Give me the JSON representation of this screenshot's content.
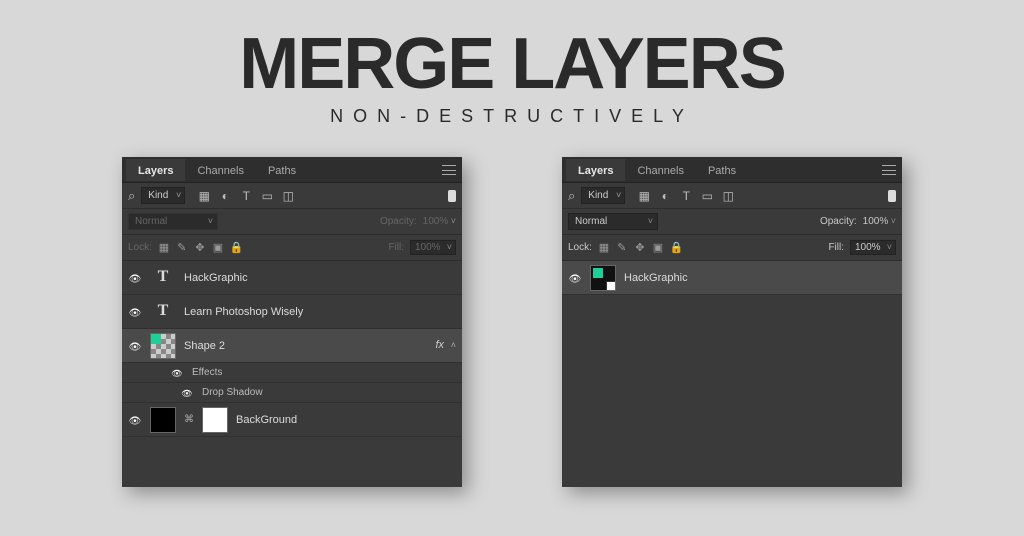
{
  "hero": {
    "title": "MERGE LAYERS",
    "subtitle": "NON-DESTRUCTIVELY"
  },
  "tabs": {
    "layers": "Layers",
    "channels": "Channels",
    "paths": "Paths"
  },
  "filter": {
    "kind": "Kind"
  },
  "blend": {
    "normal": "Normal",
    "opacity_label": "Opacity:",
    "opacity_value": "100%"
  },
  "lock": {
    "label": "Lock:",
    "fill_label": "Fill:",
    "fill_value": "100%"
  },
  "left_panel": {
    "layers": [
      {
        "name": "HackGraphic"
      },
      {
        "name": "Learn Photoshop Wisely"
      },
      {
        "name": "Shape 2"
      },
      {
        "name": "BackGround"
      }
    ],
    "effects_label": "Effects",
    "drop_shadow_label": "Drop Shadow",
    "fx_label": "fx"
  },
  "right_panel": {
    "layer_name": "HackGraphic"
  }
}
